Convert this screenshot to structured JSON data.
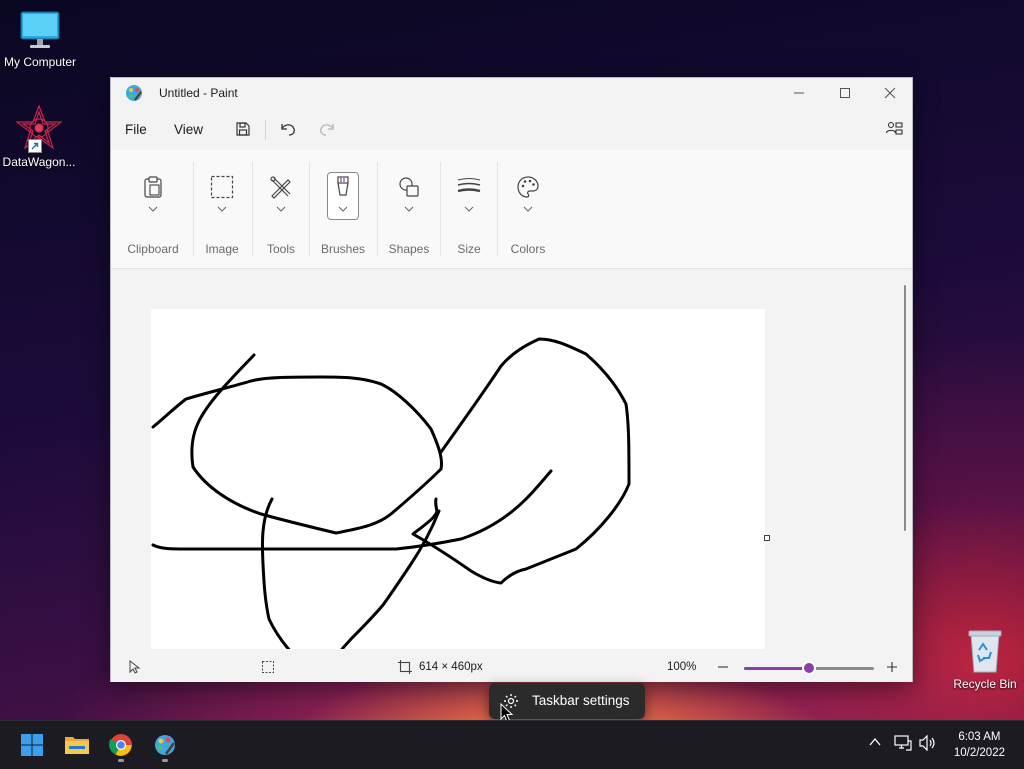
{
  "desktop": {
    "icons": [
      {
        "label": "My Computer"
      },
      {
        "label": "DataWagon..."
      },
      {
        "label": "Recycle Bin"
      }
    ]
  },
  "window": {
    "title": "Untitled - Paint",
    "menu": {
      "file": "File",
      "view": "View"
    },
    "ribbon": {
      "groups": [
        "Clipboard",
        "Image",
        "Tools",
        "Brushes",
        "Shapes",
        "Size",
        "Colors"
      ],
      "selected": "Brushes"
    },
    "status": {
      "canvas_size": "614 × 460px",
      "zoom": "100%",
      "zoom_level": 0.5
    }
  },
  "tooltip": {
    "text": "Taskbar settings"
  },
  "taskbar": {
    "apps": [
      "start-icon",
      "file-explorer-icon",
      "chrome-icon",
      "paint-icon"
    ],
    "clock": {
      "time": "6:03 AM",
      "date": "10/2/2022"
    }
  },
  "colors": {
    "accent": "#8a3fa8",
    "taskbar": "#1c1b22"
  }
}
